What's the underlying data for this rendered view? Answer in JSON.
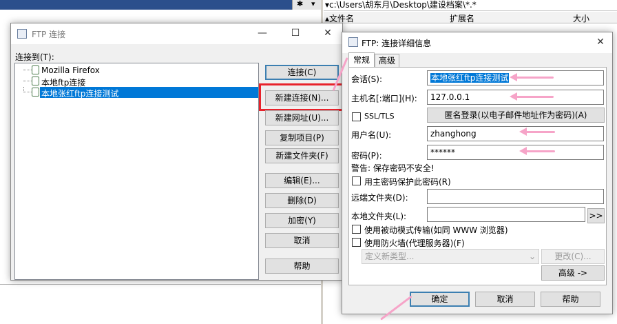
{
  "background": {
    "path": "▾c:\\Users\\胡东月\\Desktop\\建设档案\\*.*",
    "top_buttons": [
      "✱",
      "▾"
    ],
    "columns": [
      "▴文件名",
      "扩展名",
      "大小"
    ]
  },
  "ftp_connect": {
    "title": "FTP 连接",
    "list_label": "连接到(T):",
    "tree": [
      {
        "label": "Mozilla Firefox",
        "selected": false
      },
      {
        "label": "本地ftp连接",
        "selected": false
      },
      {
        "label": "本地张红ftp连接测试",
        "selected": true
      }
    ],
    "buttons": {
      "connect": "连接(C)",
      "new_connection": "新建连接(N)...",
      "new_url": "新建网址(U)...",
      "copy_item": "复制项目(P)",
      "new_folder": "新建文件夹(F)",
      "edit": "编辑(E)...",
      "delete": "删除(D)",
      "encrypt": "加密(Y)",
      "cancel": "取消",
      "help": "帮助"
    }
  },
  "details": {
    "title": "FTP: 连接详细信息",
    "tabs": [
      "常规",
      "高级"
    ],
    "labels": {
      "session": "会话(S):",
      "host": "主机名[:端口](H):",
      "ssl": "SSL/TLS",
      "user": "用户名(U):",
      "password": "密码(P):",
      "warning": "警告: 保存密码不安全!",
      "master_pwd": "用主密码保护此密码(R)",
      "remote_dir": "远端文件夹(D):",
      "local_dir": "本地文件夹(L):",
      "passive": "使用被动模式传输(如同 WWW 浏览器)",
      "firewall": "使用防火墙(代理服务器)(F)"
    },
    "values": {
      "session": "本地张红ftp连接测试",
      "host": "127.0.0.1",
      "user": "zhanghong",
      "password": "******",
      "remote_dir": "",
      "local_dir": ""
    },
    "buttons": {
      "anonymous": "匿名登录(以电子邮件地址作为密码)(A)",
      "browse": ">>",
      "proxy_type": "定义新类型...",
      "change": "更改(C)...",
      "advanced": "高级 ->",
      "ok": "确定",
      "cancel": "取消",
      "help": "帮助"
    },
    "checkboxes": {
      "ssl": false,
      "master_pwd": false,
      "passive": false,
      "firewall": false
    }
  },
  "colors": {
    "selection": "#0078d7",
    "highlight_box": "#e8222b",
    "annotation_arrow": "#f6a4c8",
    "titlebar_bg": "#2b4f8c"
  }
}
